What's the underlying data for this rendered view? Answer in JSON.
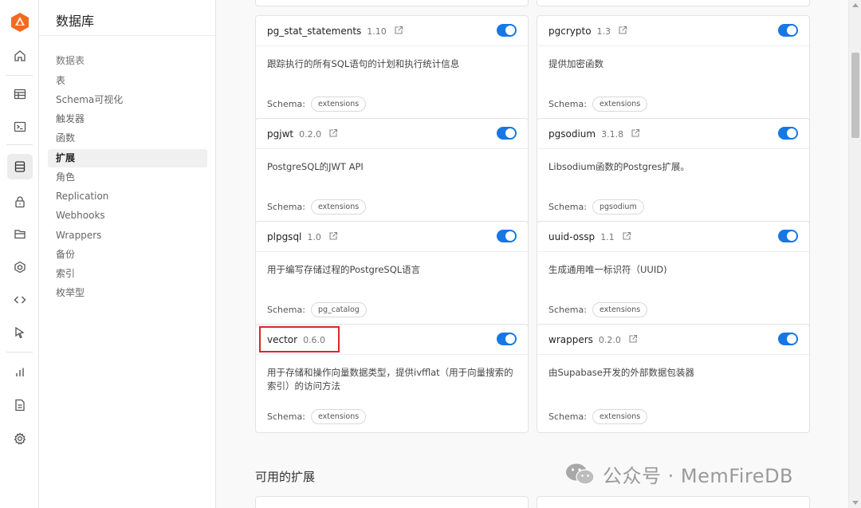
{
  "brand": {
    "accent": "#f26b1d"
  },
  "nav_rail": {
    "icons": [
      "home-icon",
      "table-icon",
      "terminal-icon",
      "database-icon",
      "lock-icon",
      "storage-icon",
      "functions-icon",
      "code-icon",
      "cursor-icon",
      "reports-icon",
      "logs-icon",
      "settings-icon"
    ],
    "active": "database-icon"
  },
  "sidebar": {
    "title": "数据库",
    "section_label": "数据表",
    "items": [
      {
        "label": "表",
        "active": false
      },
      {
        "label": "Schema可视化",
        "active": false
      },
      {
        "label": "触发器",
        "active": false
      },
      {
        "label": "函数",
        "active": false
      },
      {
        "label": "扩展",
        "active": true
      },
      {
        "label": "角色",
        "active": false
      },
      {
        "label": "Replication",
        "active": false
      },
      {
        "label": "Webhooks",
        "active": false
      },
      {
        "label": "Wrappers",
        "active": false
      },
      {
        "label": "备份",
        "active": false
      },
      {
        "label": "索引",
        "active": false
      },
      {
        "label": "枚举型",
        "active": false
      }
    ]
  },
  "extensions": {
    "schema_label": "Schema:",
    "toggle_color": "#1677e5",
    "cards": [
      {
        "name": "pg_stat_statements",
        "version": "1.10",
        "description": "跟踪执行的所有SQL语句的计划和执行统计信息",
        "schema": "extensions",
        "enabled": true
      },
      {
        "name": "pgcrypto",
        "version": "1.3",
        "description": "提供加密函数",
        "schema": "extensions",
        "enabled": true
      },
      {
        "name": "pgjwt",
        "version": "0.2.0",
        "description": "PostgreSQL的JWT API",
        "schema": "extensions",
        "enabled": true
      },
      {
        "name": "pgsodium",
        "version": "3.1.8",
        "description": "Libsodium函数的Postgres扩展。",
        "schema": "pgsodium",
        "enabled": true
      },
      {
        "name": "plpgsql",
        "version": "1.0",
        "description": "用于编写存储过程的PostgreSQL语言",
        "schema": "pg_catalog",
        "enabled": true
      },
      {
        "name": "uuid-ossp",
        "version": "1.1",
        "description": "生成通用唯一标识符（UUID)",
        "schema": "extensions",
        "enabled": true
      },
      {
        "name": "vector",
        "version": "0.6.0",
        "description": "用于存储和操作向量数据类型，提供ivfflat（用于向量搜索的索引）的访问方法",
        "schema": "extensions",
        "enabled": true,
        "highlighted": true
      },
      {
        "name": "wrappers",
        "version": "0.2.0",
        "description": "由Supabase开发的外部数据包装器",
        "schema": "extensions",
        "enabled": true
      }
    ]
  },
  "available_section": {
    "title": "可用的扩展"
  },
  "watermark": {
    "text": "公众号 · MemFireDB"
  }
}
